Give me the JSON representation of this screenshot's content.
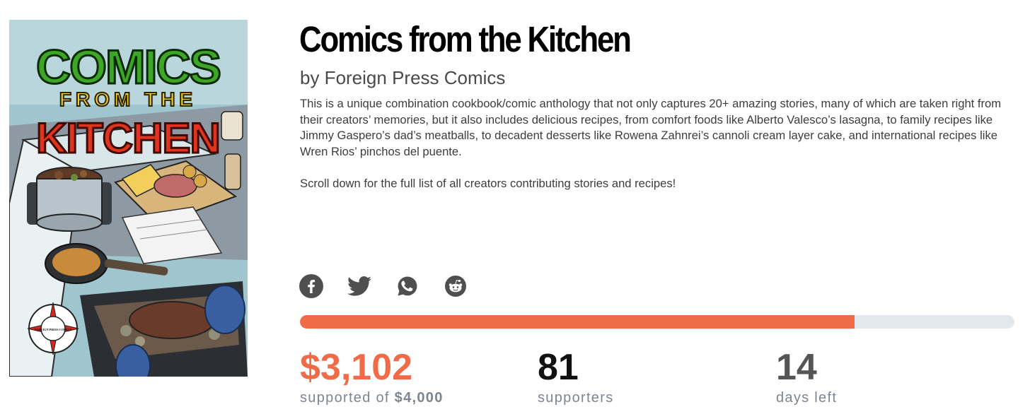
{
  "campaign": {
    "title": "Comics from the Kitchen",
    "byline": "by Foreign Press Comics",
    "description": [
      "This is a unique combination cookbook/comic anthology that not only captures 20+ amazing stories, many of which are taken right from their creators’ memories, but it also includes delicious recipes, from comfort foods like Alberto Valesco’s lasagna, to family recipes like Jimmy Gaspero’s dad’s meatballs, to decadent desserts like Rowena Zahnrei’s cannoli cream layer cake, and international recipes like Wren Rios’ pinchos del puente.",
      "Scroll down for the full list of all creators contributing stories and recipes!"
    ]
  },
  "cover": {
    "line1": "COMICS",
    "line2": "FROM THE",
    "line3": "KITCHEN",
    "publisher_logo": "FOREIGN PRESS COMICS"
  },
  "share": {
    "icons": [
      "facebook-icon",
      "twitter-icon",
      "whatsapp-icon",
      "reddit-icon"
    ]
  },
  "funding": {
    "progress_fraction": 0.776,
    "accent_color": "#f06c49",
    "track_color": "#e3e8ef"
  },
  "stats": {
    "raised": "$3,102",
    "raised_label_prefix": "supported of",
    "goal": "$4,000",
    "supporters": "81",
    "supporters_label": "supporters",
    "days": "14",
    "days_label": "days left"
  }
}
